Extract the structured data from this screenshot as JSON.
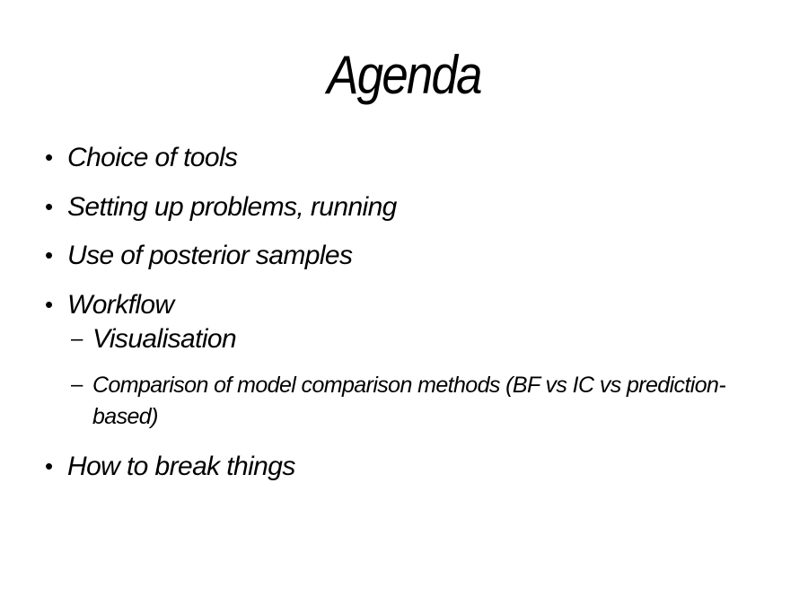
{
  "slide": {
    "title": "Agenda",
    "bullets": [
      {
        "marker": "•",
        "text": "Choice of tools"
      },
      {
        "marker": "•",
        "text": "Setting up problems, running"
      },
      {
        "marker": "•",
        "text": "Use of posterior samples"
      },
      {
        "marker": "•",
        "text": "Workflow"
      },
      {
        "marker": "–",
        "text": "Visualisation"
      },
      {
        "marker": "–",
        "text": "Comparison of model comparison methods (BF vs IC vs prediction-based)"
      },
      {
        "marker": "•",
        "text": "How to break things"
      }
    ]
  }
}
